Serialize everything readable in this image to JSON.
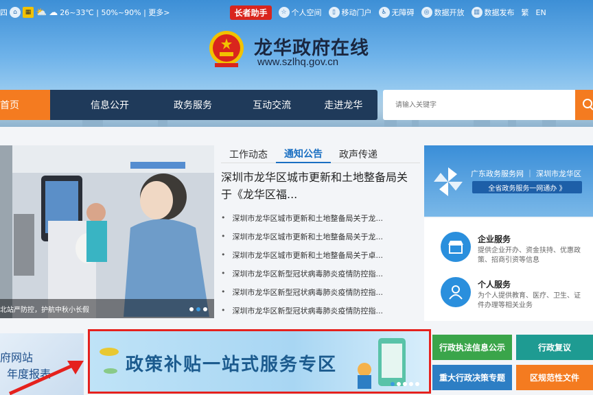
{
  "topbar": {
    "date_char": "四",
    "weather": "26~33℃ | 50%~90% | 更多>",
    "elder_mode": "长者助手",
    "links": [
      "个人空间",
      "移动门户",
      "无障碍",
      "数据开放",
      "数据发布",
      "繁",
      "EN"
    ]
  },
  "header": {
    "title": "龙华政府在线",
    "url": "www.szlhq.gov.cn"
  },
  "nav": {
    "items": [
      "首页",
      "信息公开",
      "政务服务",
      "互动交流",
      "走进龙华"
    ]
  },
  "search": {
    "placeholder": "请输入关键字"
  },
  "slider": {
    "caption": "北站严防控，护航中秋小长假"
  },
  "news": {
    "tabs": [
      "工作动态",
      "通知公告",
      "政声传递"
    ],
    "headline": "深圳市龙华区城市更新和土地整备局关于《龙华区福...",
    "items": [
      "深圳市龙华区城市更新和土地整备局关于龙...",
      "深圳市龙华区城市更新和土地整备局关于龙...",
      "深圳市龙华区城市更新和土地整备局关于卓...",
      "深圳市龙华区新型冠状病毒肺炎疫情防控指...",
      "深圳市龙华区新型冠状病毒肺炎疫情防控指...",
      "深圳市龙华区新型冠状病毒肺炎疫情防控指..."
    ]
  },
  "service": {
    "portal": "广东政务服务网 ｜ 深圳市龙华区",
    "portal_btn": "全省政务服务一网通办 》",
    "enterprise": {
      "name": "企业服务",
      "desc": "提供企业开办、资金扶持、优惠政策、招商引资等信息"
    },
    "personal": {
      "name": "个人服务",
      "desc": "为个人提供教育、医疗、卫生、证件办理等相关业务"
    }
  },
  "bottom": {
    "annual_line1": "府网站",
    "annual_line2": "年度报表",
    "promo": "政策补贴一站式服务专区",
    "buttons": [
      "行政执法信息公示",
      "行政复议",
      "重大行政决策专题",
      "区规范性文件"
    ]
  },
  "colors": {
    "accent": "#f47b20",
    "nav": "#1f3a5a",
    "highlight": "#e5211d"
  }
}
